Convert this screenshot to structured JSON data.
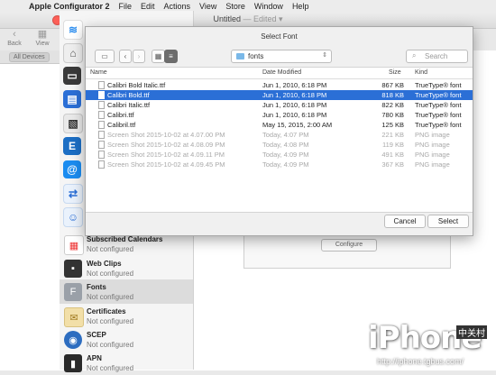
{
  "menubar": {
    "app": "Apple Configurator 2",
    "items": [
      "File",
      "Edit",
      "Actions",
      "View",
      "Store",
      "Window",
      "Help"
    ]
  },
  "window": {
    "title": "Untitled",
    "edited": "— Edited ▾"
  },
  "toolbar": {
    "back_label": "Back",
    "view_label": "View",
    "scope_tab": "All Devices"
  },
  "sidebar": {
    "items": [
      {
        "title": "Subscribed Calendars",
        "subtitle": "Not configured",
        "icon": "calendar-icon",
        "color": "#ffffff"
      },
      {
        "title": "Web Clips",
        "subtitle": "Not configured",
        "icon": "webclip-icon",
        "color": "#333333"
      },
      {
        "title": "Fonts",
        "subtitle": "Not configured",
        "icon": "font-icon",
        "color": "#9aa0a8"
      },
      {
        "title": "Certificates",
        "subtitle": "Not configured",
        "icon": "certificate-icon",
        "color": "#f2dfa8"
      },
      {
        "title": "SCEP",
        "subtitle": "Not configured",
        "icon": "scep-icon",
        "color": "#2d6dc0"
      },
      {
        "title": "APN",
        "subtitle": "Not configured",
        "icon": "apn-icon",
        "color": "#2a2a2a"
      }
    ]
  },
  "background": {
    "configure_label": "Configure"
  },
  "dialog": {
    "title": "Select Font",
    "location": "fonts",
    "search_placeholder": "Search",
    "columns": {
      "name": "Name",
      "date": "Date Modified",
      "size": "Size",
      "kind": "Kind"
    },
    "files": [
      {
        "name": "Calibri Bold Italic.ttf",
        "date": "Jun 1, 2010, 6:18 PM",
        "size": "867 KB",
        "kind": "TrueType® font",
        "state": "normal"
      },
      {
        "name": "Calibri Bold.ttf",
        "date": "Jun 1, 2010, 6:18 PM",
        "size": "818 KB",
        "kind": "TrueType® font",
        "state": "selected"
      },
      {
        "name": "Calibri Italic.ttf",
        "date": "Jun 1, 2010, 6:18 PM",
        "size": "822 KB",
        "kind": "TrueType® font",
        "state": "normal"
      },
      {
        "name": "Calibri.ttf",
        "date": "Jun 1, 2010, 6:18 PM",
        "size": "780 KB",
        "kind": "TrueType® font",
        "state": "normal"
      },
      {
        "name": "Calibril.ttf",
        "date": "May 15, 2015, 2:00 AM",
        "size": "125 KB",
        "kind": "TrueType® font",
        "state": "normal"
      },
      {
        "name": "Screen Shot 2015-10-02 at 4.07.00 PM",
        "date": "Today, 4:07 PM",
        "size": "221 KB",
        "kind": "PNG image",
        "state": "disabled"
      },
      {
        "name": "Screen Shot 2015-10-02 at 4.08.09 PM",
        "date": "Today, 4:08 PM",
        "size": "119 KB",
        "kind": "PNG image",
        "state": "disabled"
      },
      {
        "name": "Screen Shot 2015-10-02 at 4.09.11 PM",
        "date": "Today, 4:09 PM",
        "size": "491 KB",
        "kind": "PNG image",
        "state": "disabled"
      },
      {
        "name": "Screen Shot 2015-10-02 at 4.09.45 PM",
        "date": "Today, 4:09 PM",
        "size": "367 KB",
        "kind": "PNG image",
        "state": "disabled"
      }
    ],
    "cancel_label": "Cancel",
    "select_label": "Select"
  },
  "watermark": {
    "brand": "iPhone",
    "cn": "中关村",
    "url": "http://iphone.tgbus.com/"
  },
  "colors": {
    "selection": "#2b6fd6",
    "accent_blue": "#1b8cf0"
  }
}
